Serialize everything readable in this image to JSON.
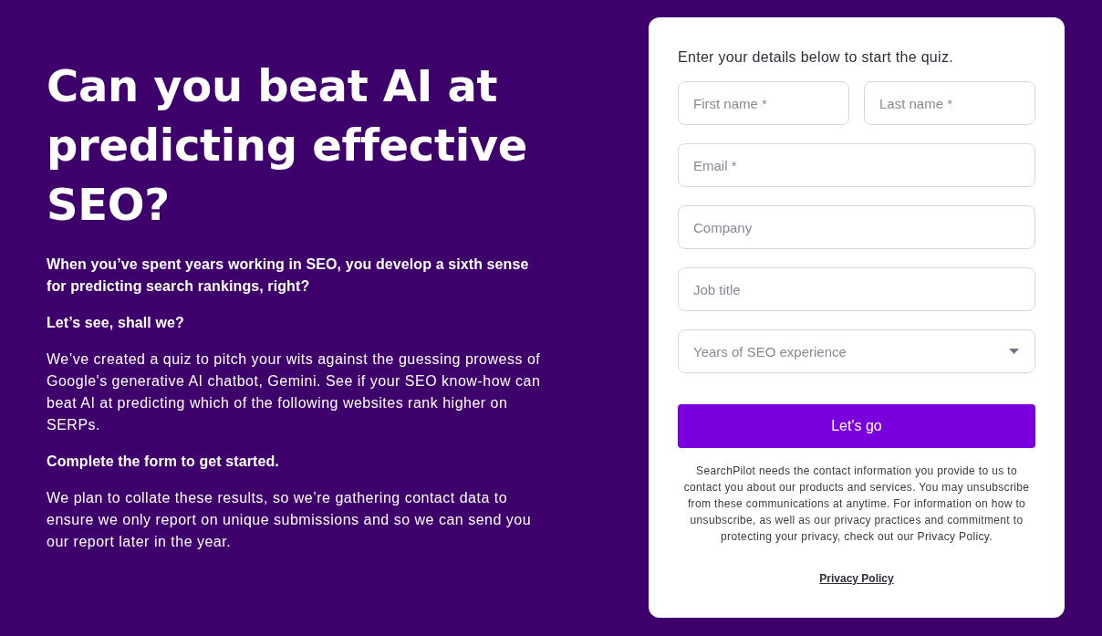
{
  "hero": {
    "title": "Can you beat AI at predicting effective SEO?",
    "paragraphs": [
      {
        "kind": "bold",
        "text": "When you’ve spent years working in SEO, you develop a sixth sense for predicting search rankings, right?"
      },
      {
        "kind": "bold",
        "text": "Let’s see, shall we?"
      },
      {
        "kind": "regular",
        "text": "We’ve created a quiz to pitch your wits against the guessing prowess of Google's generative AI chatbot, Gemini. See if your SEO know-how can beat AI at predicting which of the following websites rank higher on SERPs."
      },
      {
        "kind": "bold",
        "text": "Complete the form to get started."
      },
      {
        "kind": "regular",
        "text": "We plan to collate these results, so we’re gathering contact data to ensure we only report on unique submissions and so we can send you our report later in the year."
      }
    ]
  },
  "form": {
    "intro": "Enter your details below to start the quiz.",
    "field_rows": [
      [
        {
          "kind": "text",
          "placeholder": "First name *"
        },
        {
          "kind": "text",
          "placeholder": "Last name *"
        }
      ],
      [
        {
          "kind": "text",
          "placeholder": "Email *"
        }
      ],
      [
        {
          "kind": "text",
          "placeholder": "Company"
        }
      ],
      [
        {
          "kind": "text",
          "placeholder": "Job title"
        }
      ],
      [
        {
          "kind": "select",
          "placeholder": "Years of SEO experience"
        }
      ]
    ],
    "submit_button": "Let's go",
    "disclaimer": "SearchPilot needs the contact information you provide to us to contact you about our products and services. You may unsubscribe from these communications at anytime. For information on how to unsubscribe, as well as our privacy practices and commitment to protecting your privacy, check out our Privacy Policy.",
    "privacy_link": "Privacy Policy"
  }
}
